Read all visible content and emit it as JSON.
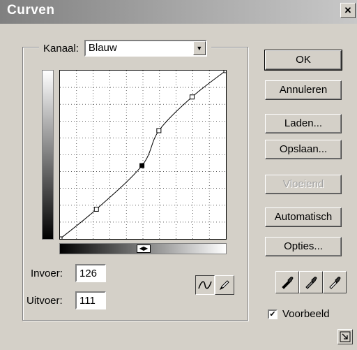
{
  "window": {
    "title": "Curven",
    "close_label": "×"
  },
  "channel": {
    "label": "Kanaal:",
    "value": "Blauw",
    "dropdown_arrow": "▼"
  },
  "curve": {
    "points": [
      [
        0,
        0
      ],
      [
        56,
        45
      ],
      [
        126,
        111
      ],
      [
        152,
        164
      ],
      [
        203,
        215
      ],
      [
        255,
        255
      ]
    ],
    "grid_divisions": 10,
    "input_range": [
      0,
      255
    ],
    "output_range": [
      0,
      255
    ]
  },
  "gradient_toggle_label": "◀▶",
  "input": {
    "label": "Invoer:",
    "value": "126"
  },
  "output": {
    "label": "Uitvoer:",
    "value": "111"
  },
  "mode_buttons": [
    {
      "icon": "curve-tool-icon",
      "active": true
    },
    {
      "icon": "pencil-tool-icon",
      "active": false
    }
  ],
  "buttons": {
    "ok": "OK",
    "cancel": "Annuleren",
    "load": "Laden...",
    "save": "Opslaan...",
    "smooth": "Vloeiend",
    "auto": "Automatisch",
    "options": "Opties..."
  },
  "eyedroppers": [
    "black-eyedropper-icon",
    "gray-eyedropper-icon",
    "white-eyedropper-icon"
  ],
  "preview": {
    "label": "Voorbeeld",
    "checked": true,
    "mark": "✔"
  },
  "corner_icon": "expand-icon"
}
